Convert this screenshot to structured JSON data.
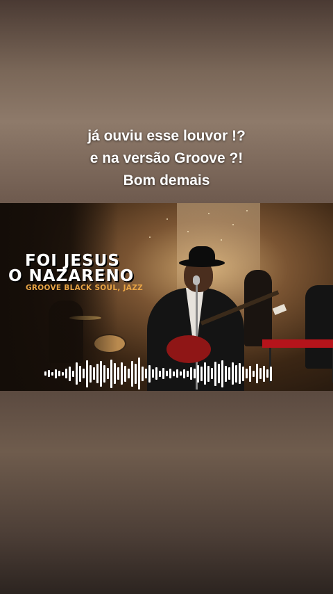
{
  "caption": {
    "line1": "já ouviu esse louvor !?",
    "line2": "e na versão Groove ?!",
    "line3": "Bom demais"
  },
  "video": {
    "title_line1": "FOI JESUS",
    "title_line2": "O NAZARENO",
    "subtitle": "GROOVE BLACK SOUL, JAZZ",
    "waveform_levels": [
      0.12,
      0.22,
      0.1,
      0.28,
      0.18,
      0.1,
      0.3,
      0.45,
      0.2,
      0.7,
      0.5,
      0.3,
      0.85,
      0.55,
      0.4,
      0.6,
      0.8,
      0.55,
      0.35,
      0.9,
      0.65,
      0.4,
      0.7,
      0.5,
      0.3,
      0.8,
      0.62,
      1.0,
      0.45,
      0.3,
      0.55,
      0.25,
      0.4,
      0.2,
      0.35,
      0.18,
      0.3,
      0.15,
      0.25,
      0.12,
      0.28,
      0.2,
      0.4,
      0.3,
      0.55,
      0.45,
      0.7,
      0.5,
      0.35,
      0.75,
      0.6,
      0.85,
      0.5,
      0.4,
      0.7,
      0.55,
      0.65,
      0.45,
      0.3,
      0.5,
      0.2,
      0.6,
      0.35,
      0.5,
      0.25,
      0.45
    ]
  }
}
